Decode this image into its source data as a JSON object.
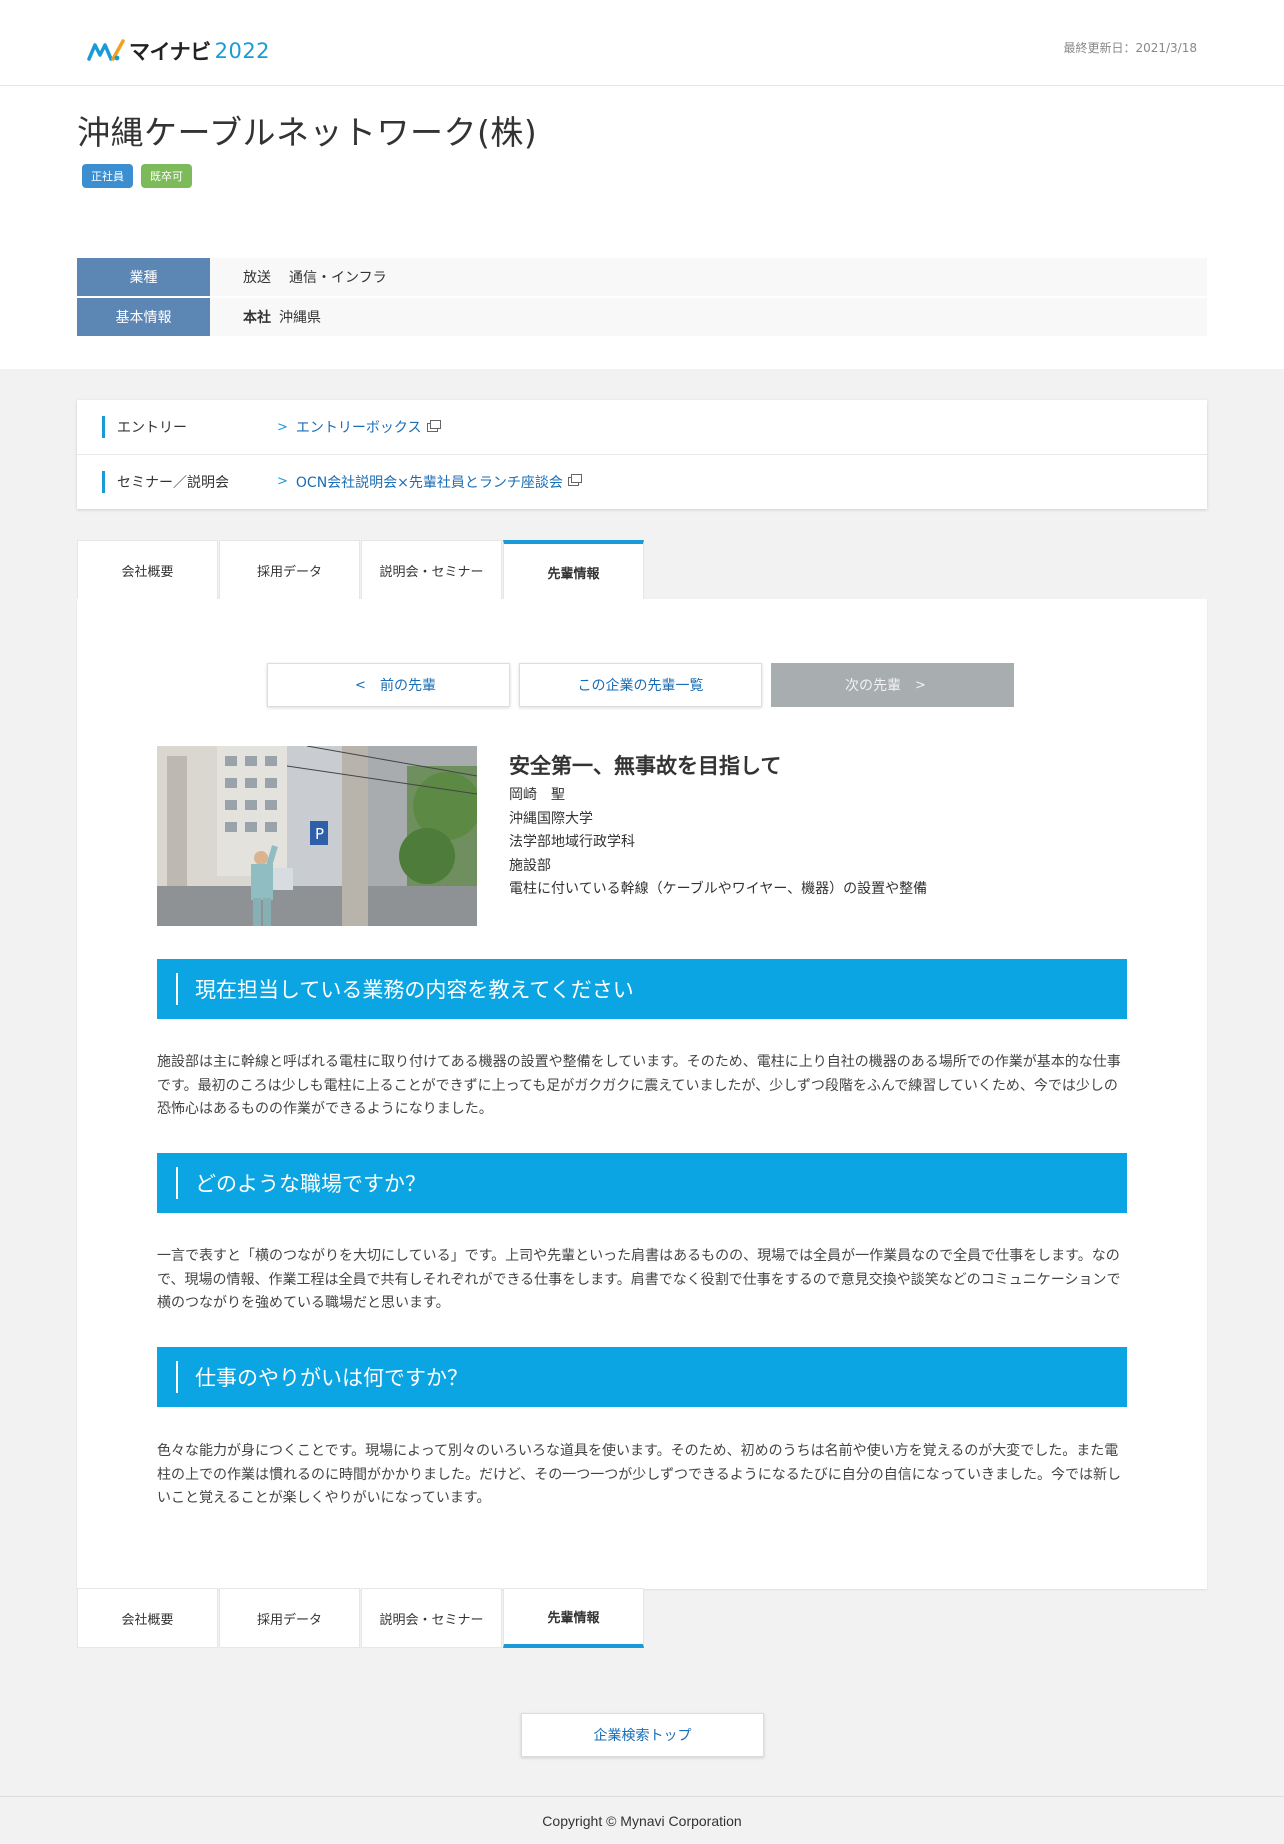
{
  "header": {
    "logo_text": "マイナビ",
    "logo_year": "2022",
    "updated": "最終更新日：2021/3/18"
  },
  "company": {
    "name": "沖縄ケーブルネットワーク(株)",
    "badges": [
      "正社員",
      "既卒可"
    ]
  },
  "info": {
    "industry_label": "業種",
    "industry_values": [
      "放送",
      "通信・インフラ"
    ],
    "basic_label": "基本情報",
    "hq_label": "本社",
    "hq_value": "沖縄県"
  },
  "links": [
    {
      "label": "エントリー",
      "target": "エントリーボックス"
    },
    {
      "label": "セミナー／説明会",
      "target": "OCN会社説明会×先輩社員とランチ座談会"
    }
  ],
  "tabs": [
    "会社概要",
    "採用データ",
    "説明会・セミナー",
    "先輩情報"
  ],
  "nav": {
    "prev": "前の先輩",
    "list": "この企業の先輩一覧",
    "next": "次の先輩",
    "prev_arrow": "<",
    "next_arrow": ">"
  },
  "profile": {
    "title": "安全第一、無事故を目指して",
    "name": "岡崎　聖",
    "university": "沖縄国際大学",
    "faculty": "法学部地域行政学科",
    "department": "施設部",
    "work": "電柱に付いている幹線（ケーブルやワイヤー、機器）の設置や整備"
  },
  "qa": [
    {
      "q": "現在担当している業務の内容を教えてください",
      "a": "施設部は主に幹線と呼ばれる電柱に取り付けてある機器の設置や整備をしています。そのため、電柱に上り自社の機器のある場所での作業が基本的な仕事です。最初のころは少しも電柱に上ることができずに上っても足がガクガクに震えていましたが、少しずつ段階をふんで練習していくため、今では少しの恐怖心はあるものの作業ができるようになりました。"
    },
    {
      "q": "どのような職場ですか？",
      "a": "一言で表すと「横のつながりを大切にしている」です。上司や先輩といった肩書はあるものの、現場では全員が一作業員なので全員で仕事をします。なので、現場の情報、作業工程は全員で共有しそれぞれができる仕事をします。肩書でなく役割で仕事をするので意見交換や談笑などのコミュニケーションで横のつながりを強めている職場だと思います。"
    },
    {
      "q": "仕事のやりがいは何ですか？",
      "a": "色々な能力が身につくことです。現場によって別々のいろいろな道具を使います。そのため、初めのうちは名前や使い方を覚えるのが大変でした。また電柱の上での作業は慣れるのに時間がかかりました。だけど、その一つ一つが少しずつできるようになるたびに自分の自信になっていきました。今では新しいこと覚えることが楽しくやりがいになっています。"
    }
  ],
  "search_top": "企業検索トップ",
  "footer": "Copyright © Mynavi Corporation",
  "colors": {
    "accent": "#0aa5e2",
    "link": "#1a6db5",
    "table_head": "#5c87b4",
    "badge_blue": "#3b8fd1",
    "badge_green": "#7dba5a"
  }
}
